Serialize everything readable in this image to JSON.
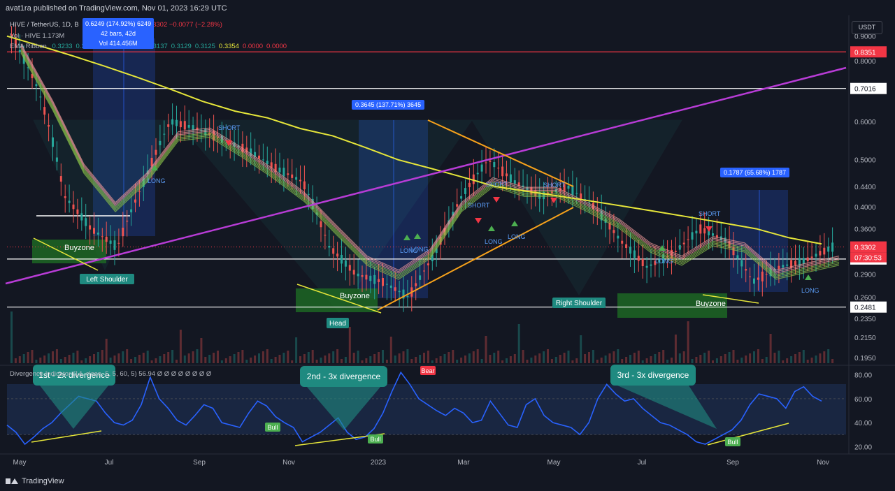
{
  "header": {
    "published": "avat1ra published on TradingView.com, Nov 01, 2023 16:29 UTC"
  },
  "legend": {
    "symbol": "HIVE / TetherUS, 1D, B",
    "ohlc_tail": "H 0.3278  L 0.3278  C 0.3302  −0.0077 (−2.28%)",
    "vol": "Vol · HIVE  1.173M",
    "ema": "EMA Ribbon",
    "ema_values": [
      "0.3233",
      "0.3209",
      "0.3163",
      "0.3148",
      "0.3137",
      "0.3129",
      "0.3125",
      "0.3354",
      "0.0000",
      "0.0000"
    ]
  },
  "measure_top": {
    "line1": "0.6249 (174.92%) 6249",
    "line2": "42 bars, 42d",
    "line3": "Vol 414.456M"
  },
  "measure_mid": "0.3645 (137.71%) 3645",
  "measure_right": "0.1787 (65.68%) 1787",
  "rsi_legend": "Divergence Indicator (14, close, 5, 5, 60, 5)  56.94  Ø  Ø  Ø  Ø  Ø  Ø  Ø  Ø",
  "currency_button": "USDT",
  "footer": "TradingView",
  "colors": {
    "background": "#131722",
    "ema_long": "#e6e63a",
    "purple_trend": "#b83cd6",
    "orange": "#f7a21b",
    "red_line": "#f23645",
    "rsi": "#2962ff",
    "teal": "#26a69a",
    "buyzone": "#1e6b24"
  },
  "chart_data": {
    "type": "line",
    "title": "HIVE / TetherUS, 1D",
    "x_ticks": [
      "May",
      "Jul",
      "Sep",
      "Nov",
      "2023",
      "Mar",
      "May",
      "Jul",
      "Sep",
      "Nov"
    ],
    "price_axis_ticks": [
      "0.9000",
      "0.8000",
      "0.6000",
      "0.5000",
      "0.4400",
      "0.4000",
      "0.3600",
      "0.2900",
      "0.2600",
      "0.2350",
      "0.2150",
      "0.1950"
    ],
    "price_axis_labels": [
      {
        "value": 0.8351,
        "text": "0.8351",
        "color": "#f23645"
      },
      {
        "value": 0.7016,
        "text": "0.7016",
        "color": "#ffffff"
      },
      {
        "value": 0.3302,
        "text": "0.3302",
        "color": "#f23645"
      },
      {
        "value": 0.3118,
        "text": "0.3118",
        "color": "#ffffff"
      },
      {
        "value": 0.2481,
        "text": "0.2481",
        "color": "#ffffff"
      }
    ],
    "countdown": "07:30:53",
    "price_scale": "log",
    "ylim": [
      0.19,
      1.0
    ],
    "horizontal_levels": [
      {
        "price": 0.8351,
        "color": "#f23645"
      },
      {
        "price": 0.7016,
        "color": "#ffffff"
      },
      {
        "price": 0.3118,
        "color": "#ffffff"
      },
      {
        "price": 0.2481,
        "color": "#ffffff"
      }
    ],
    "ema_long_series": [
      0.9,
      0.86,
      0.82,
      0.78,
      0.74,
      0.7,
      0.66,
      0.63,
      0.61,
      0.58,
      0.56,
      0.53,
      0.5,
      0.48,
      0.46,
      0.44,
      0.43,
      0.42,
      0.41,
      0.4,
      0.39,
      0.38,
      0.37,
      0.36,
      0.345,
      0.335
    ],
    "ribbon_series": [
      0.85,
      0.65,
      0.48,
      0.4,
      0.46,
      0.56,
      0.57,
      0.52,
      0.47,
      0.42,
      0.36,
      0.31,
      0.29,
      0.32,
      0.4,
      0.45,
      0.43,
      0.43,
      0.4,
      0.37,
      0.33,
      0.31,
      0.34,
      0.33,
      0.29,
      0.3,
      0.31
    ],
    "price_series": [
      0.9,
      0.7,
      0.42,
      0.36,
      0.33,
      0.45,
      0.6,
      0.58,
      0.55,
      0.52,
      0.48,
      0.45,
      0.33,
      0.29,
      0.28,
      0.26,
      0.32,
      0.42,
      0.5,
      0.45,
      0.42,
      0.44,
      0.4,
      0.34,
      0.3,
      0.32,
      0.36,
      0.34,
      0.28,
      0.3,
      0.31,
      0.33
    ],
    "rsi_panel": {
      "ticks": [
        "80.00",
        "60.00",
        "40.00",
        "20.00"
      ],
      "ylim": [
        15,
        85
      ],
      "series": [
        38,
        32,
        22,
        28,
        35,
        40,
        48,
        55,
        62,
        60,
        58,
        48,
        40,
        38,
        42,
        55,
        78,
        60,
        52,
        42,
        38,
        46,
        55,
        52,
        40,
        38,
        36,
        48,
        58,
        54,
        45,
        40,
        36,
        24,
        28,
        32,
        38,
        44,
        32,
        26,
        28,
        35,
        48,
        66,
        82,
        72,
        60,
        55,
        50,
        46,
        52,
        48,
        40,
        42,
        58,
        48,
        38,
        36,
        55,
        60,
        46,
        40,
        38,
        36,
        30,
        40,
        60,
        72,
        64,
        58,
        60,
        52,
        46,
        40,
        38,
        34,
        30,
        24,
        22,
        26,
        30,
        34,
        42,
        55,
        64,
        62,
        60,
        52,
        66,
        70,
        62,
        58
      ]
    },
    "rsi_labels": [
      "Bear",
      "Bull",
      "Bull",
      "Bull"
    ],
    "annotations": {
      "buyzones": [
        "Buyzone",
        "Buyzone",
        "Buyzone"
      ],
      "pattern": [
        "Left Shoulder",
        "Head",
        "Right Shoulder"
      ],
      "short_labels": [
        "SHORT",
        "SHORT",
        "SHORT",
        "SHORT",
        "SHORT"
      ],
      "long_labels": [
        "LONG",
        "LONG",
        "LONG",
        "LONG",
        "LONG",
        "LONG",
        "LONG"
      ],
      "divergence_boxes": [
        "1st - 2x divergence",
        "2nd - 3x divergence",
        "3rd - 3x divergence"
      ]
    }
  }
}
